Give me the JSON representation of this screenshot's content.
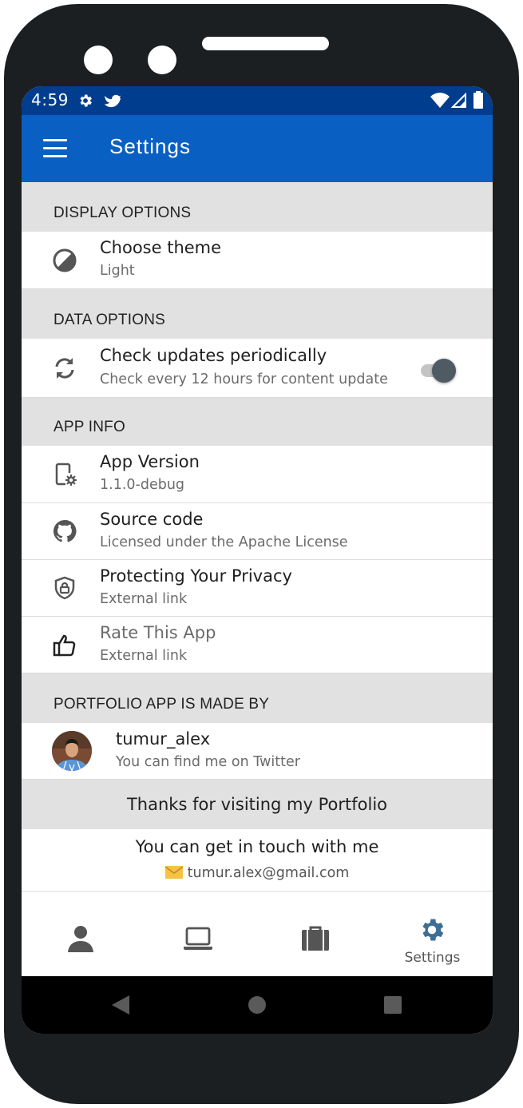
{
  "status_bar": {
    "time": "4:59",
    "icons": [
      "gear-icon",
      "bird-icon",
      "wifi-icon",
      "signal-icon",
      "battery-icon"
    ]
  },
  "app_bar": {
    "title": "Settings",
    "menu_icon": "menu-icon"
  },
  "sections": {
    "display": {
      "header": "DISPLAY OPTIONS",
      "theme": {
        "title": "Choose theme",
        "subtitle": "Light",
        "icon": "theme-contrast-icon"
      }
    },
    "data": {
      "header": "DATA OPTIONS",
      "updates": {
        "title": "Check updates periodically",
        "subtitle": "Check every 12 hours for content update",
        "icon": "sync-icon",
        "toggle_on": true
      }
    },
    "app_info": {
      "header": "APP INFO",
      "items": [
        {
          "title": "App Version",
          "subtitle": "1.1.0-debug",
          "icon": "app-settings-icon"
        },
        {
          "title": "Source code",
          "subtitle": "Licensed under the Apache License",
          "icon": "github-icon"
        },
        {
          "title": "Protecting Your Privacy",
          "subtitle": "External link",
          "icon": "shield-lock-icon"
        },
        {
          "title": "Rate This App",
          "subtitle": "External link",
          "icon": "thumbs-up-icon"
        }
      ]
    },
    "author": {
      "header": "PORTFOLIO APP IS MADE BY",
      "name": "tumur_alex",
      "subtitle": "You can find me on Twitter"
    }
  },
  "footer": {
    "thanks": "Thanks for visiting my Portfolio",
    "contact_heading": "You can get in touch with me",
    "email": "tumur.alex@gmail.com",
    "email_icon": "envelope-icon"
  },
  "bottom_nav": [
    {
      "icon": "person-icon",
      "label": ""
    },
    {
      "icon": "laptop-icon",
      "label": ""
    },
    {
      "icon": "briefcase-icon",
      "label": ""
    },
    {
      "icon": "gear-icon",
      "label": "Settings",
      "active": true
    }
  ],
  "colors": {
    "status_bar": "#003d8f",
    "app_bar": "#0a5fc2",
    "section_bg": "#e1e1e1",
    "active_nav": "#3c6e96"
  }
}
